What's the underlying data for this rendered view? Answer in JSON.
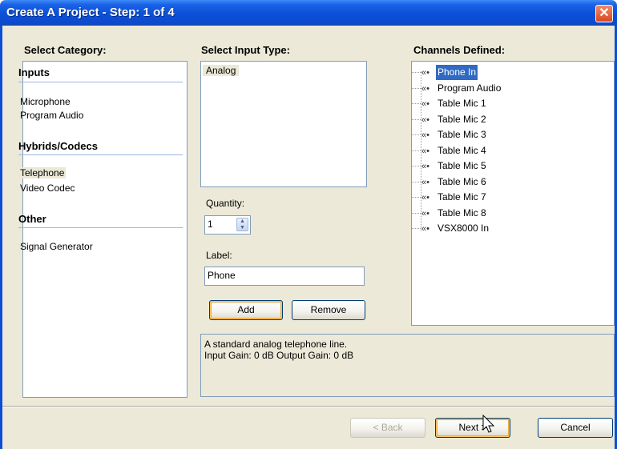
{
  "window": {
    "title": "Create A Project - Step: 1 of 4",
    "close_glyph": "✕"
  },
  "category": {
    "header": "Select Category:",
    "sections": [
      {
        "title": "Inputs",
        "items": [
          "Microphone",
          "Program Audio"
        ]
      },
      {
        "title": "Hybrids/Codecs",
        "items": [
          "Telephone",
          "Video Codec"
        ]
      },
      {
        "title": "Other",
        "items": [
          "Signal Generator"
        ]
      }
    ],
    "selected_item": "Telephone"
  },
  "input_type": {
    "header": "Select Input Type:",
    "items": [
      "Analog"
    ],
    "selected": "Analog"
  },
  "quantity": {
    "label": "Quantity:",
    "value": "1"
  },
  "label_field": {
    "label": "Label:",
    "value": "Phone"
  },
  "buttons": {
    "add": "Add",
    "remove": "Remove",
    "back": "< Back",
    "next": "Next >",
    "cancel": "Cancel"
  },
  "description": {
    "line1": "A standard analog telephone line.",
    "line2": "Input Gain: 0 dB   Output Gain: 0 dB"
  },
  "channels": {
    "header": "Channels Defined:",
    "items": [
      "Phone In",
      "Program Audio",
      "Table Mic 1",
      "Table Mic 2",
      "Table Mic 3",
      "Table Mic 4",
      "Table Mic 5",
      "Table Mic 6",
      "Table Mic 7",
      "Table Mic 8",
      "VSX8000 In"
    ],
    "selected": "Phone In",
    "icon": "channel-icon"
  },
  "colors": {
    "titlebar": "#0a50d8",
    "selection": "#316ac5",
    "dialog_bg": "#ece9d8"
  }
}
